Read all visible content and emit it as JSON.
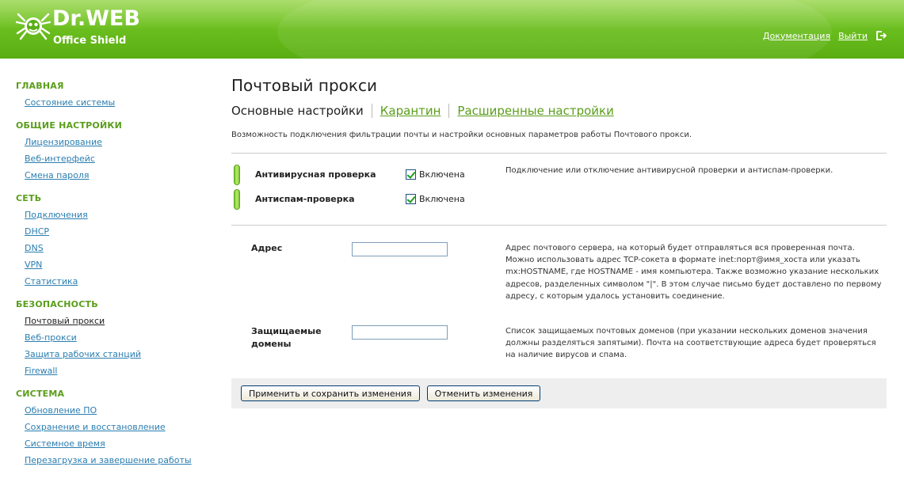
{
  "header": {
    "logo_name": "Dr.WEB",
    "logo_sub": "Office Shield",
    "docs_link": "Документация",
    "exit_link": "Выйти"
  },
  "sidebar": {
    "sections": [
      {
        "title": "ГЛАВНАЯ",
        "items": [
          {
            "label": "Состояние системы"
          }
        ]
      },
      {
        "title": "ОБЩИЕ НАСТРОЙКИ",
        "items": [
          {
            "label": "Лицензирование"
          },
          {
            "label": "Веб-интерфейс"
          },
          {
            "label": "Смена пароля"
          }
        ]
      },
      {
        "title": "СЕТЬ",
        "items": [
          {
            "label": "Подключения"
          },
          {
            "label": "DHCP"
          },
          {
            "label": "DNS"
          },
          {
            "label": "VPN"
          },
          {
            "label": "Статистика"
          }
        ]
      },
      {
        "title": "БЕЗОПАСНОСТЬ",
        "items": [
          {
            "label": "Почтовый прокси",
            "active": true
          },
          {
            "label": "Веб-прокси"
          },
          {
            "label": "Защита рабочих станций"
          },
          {
            "label": "Firewall"
          }
        ]
      },
      {
        "title": "СИСТЕМА",
        "items": [
          {
            "label": "Обновление ПО"
          },
          {
            "label": "Сохранение и восстановление"
          },
          {
            "label": "Системное время"
          },
          {
            "label": "Перезагрузка и завершение работы"
          }
        ]
      }
    ]
  },
  "main": {
    "title": "Почтовый прокси",
    "tabs": [
      {
        "label": "Основные настройки",
        "active": true
      },
      {
        "label": "Карантин"
      },
      {
        "label": "Расширенные настройки"
      }
    ],
    "description": "Возможность подключения фильтрации почты и настройки основных параметров работы Почтового прокси.",
    "toggles": [
      {
        "label": "Антивирусная проверка",
        "checkbox_label": "Включена",
        "checked": true
      },
      {
        "label": "Антиспам-проверка",
        "checkbox_label": "Включена",
        "checked": true
      }
    ],
    "toggles_help": "Подключение или отключение антивирусной проверки и антиспам-проверки.",
    "fields": [
      {
        "label": "Адрес",
        "value": "",
        "help": "Адрес почтового сервера, на который будет отправляться вся проверенная почта. Можно использовать адрес TCP-сокета в формате inet:порт@имя_хоста или указать mx:HOSTNAME, где HOSTNAME - имя компьютера. Также возможно указание нескольких адресов, разделенных символом \"|\". В этом случае письмо будет доставлено по первому адресу, с которым удалось установить соединение."
      },
      {
        "label": "Защищаемые домены",
        "value": "",
        "help": "Список защищаемых почтовых доменов (при указании нескольких доменов значения должны разделяться запятыми). Почта на соответствующие адреса будет проверяться на наличие вирусов и спама."
      }
    ],
    "buttons": {
      "apply": "Применить и сохранить изменения",
      "cancel": "Отменить изменения"
    }
  },
  "colors": {
    "header_green": "#6cbf1f",
    "section_green": "#5a9d1a",
    "link_blue": "#2b7eb0"
  }
}
